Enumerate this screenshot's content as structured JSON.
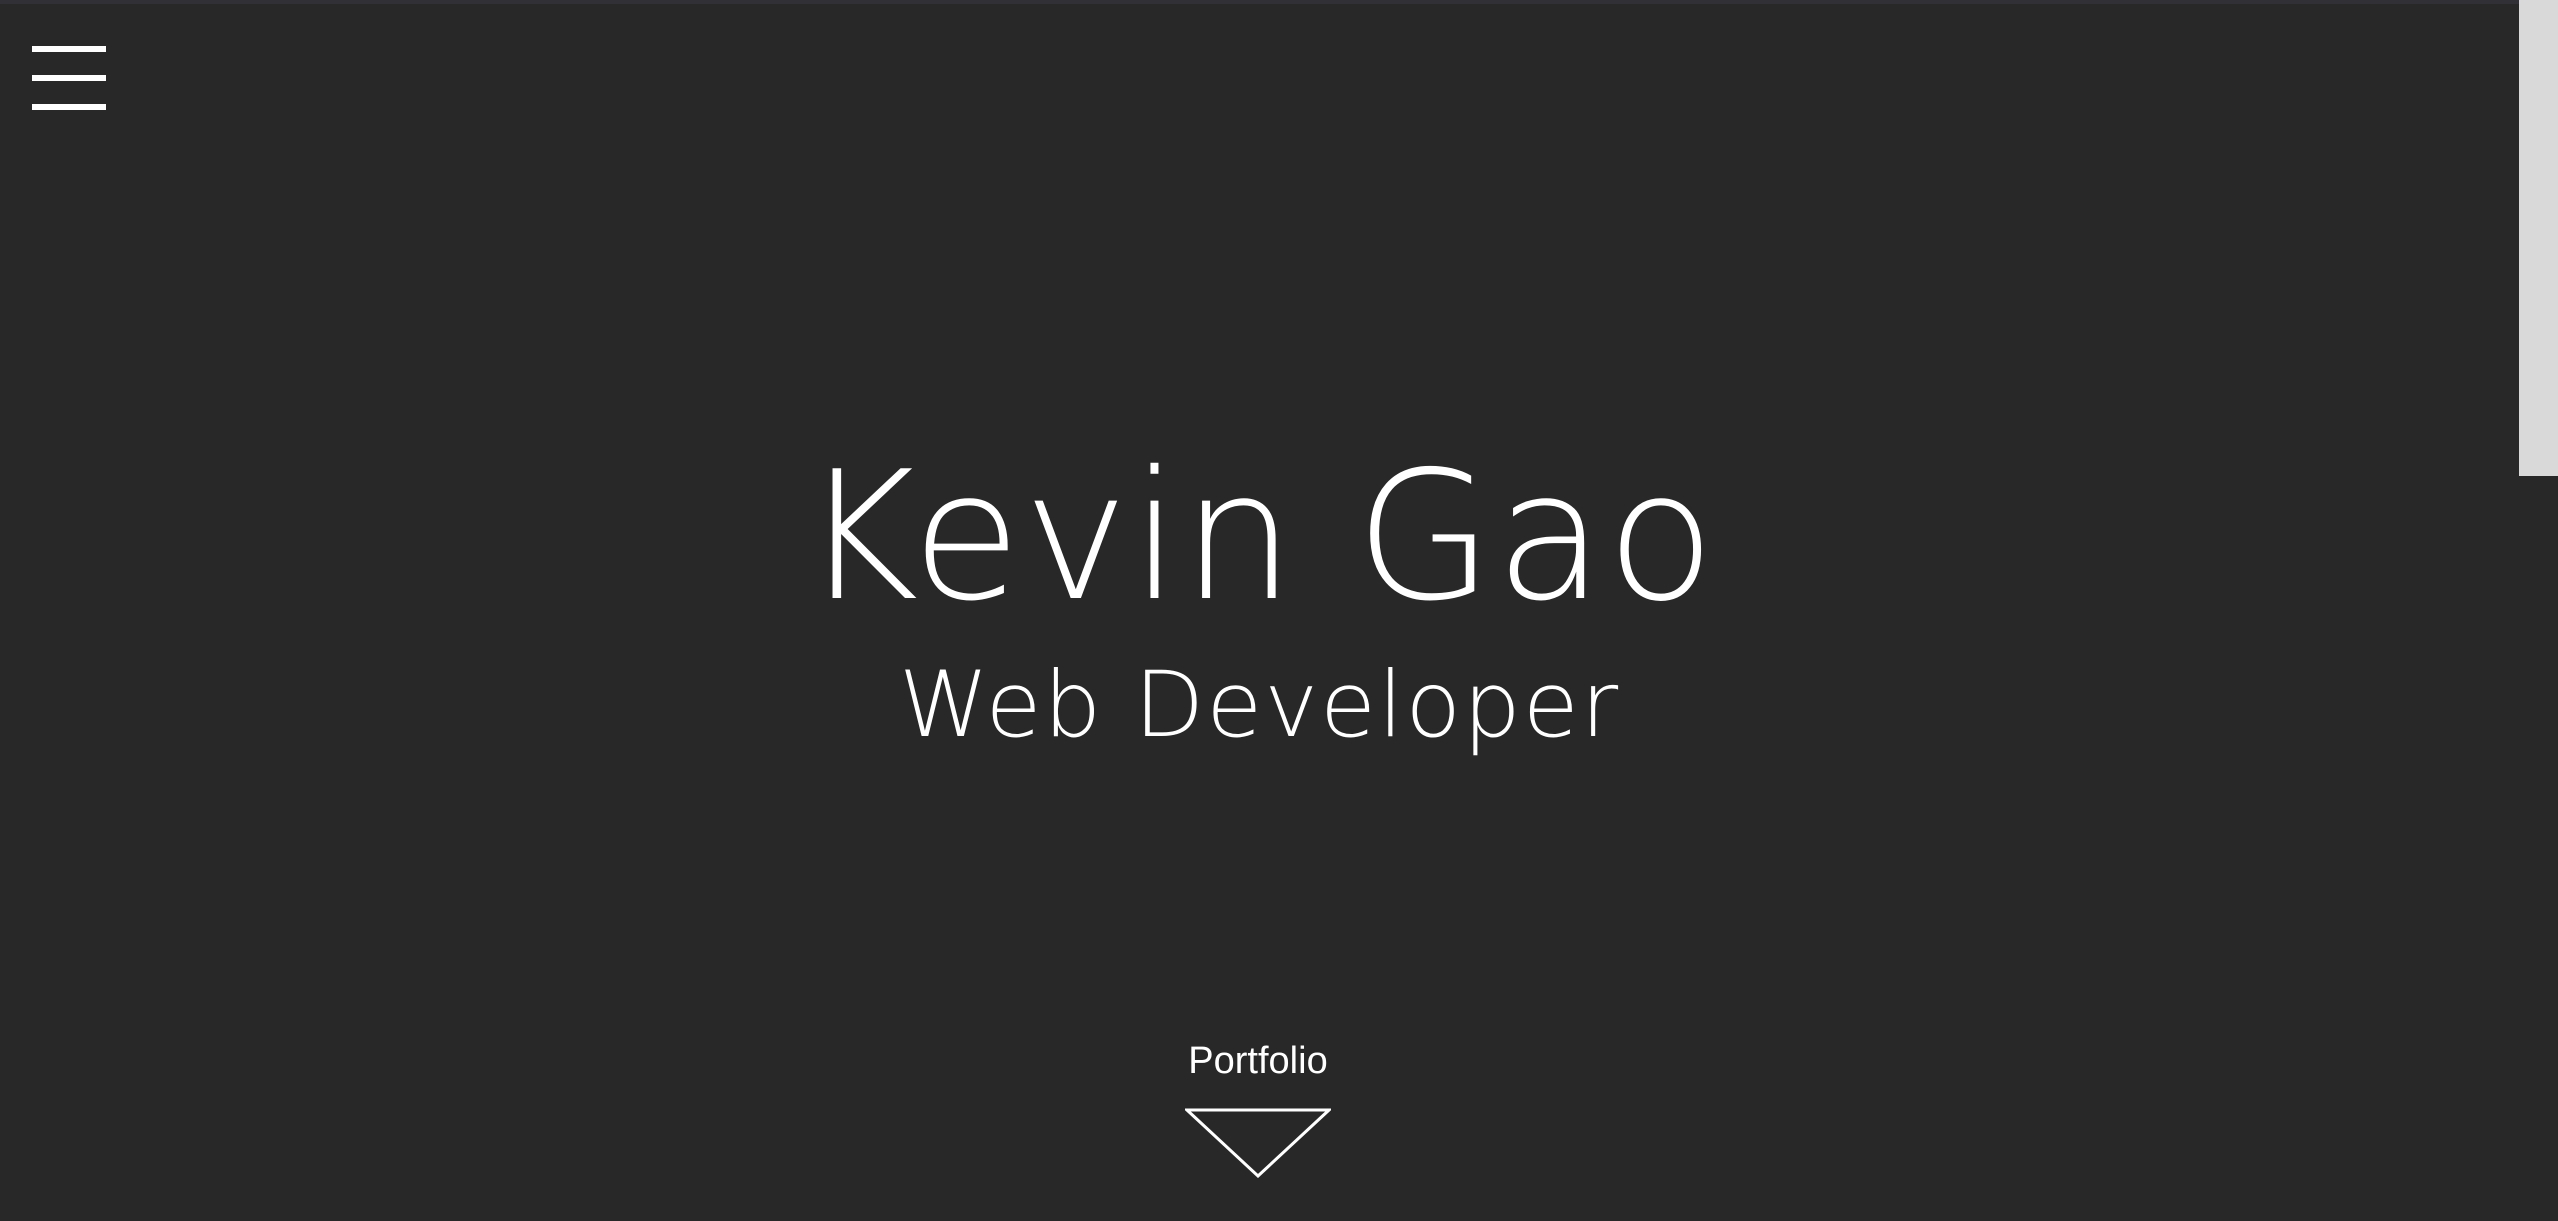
{
  "menu": {
    "icon": "hamburger-menu-icon"
  },
  "hero": {
    "name": "Kevin Gao",
    "role": "Web Developer"
  },
  "portfolio": {
    "label": "Portfolio",
    "icon": "triangle-down-icon"
  },
  "scrollbar": {
    "position_fraction": 0.0,
    "visible_fraction": 0.39
  },
  "colors": {
    "background": "#282828",
    "text": "#ffffff",
    "scrollbar_thumb": "#d9d9d9"
  }
}
